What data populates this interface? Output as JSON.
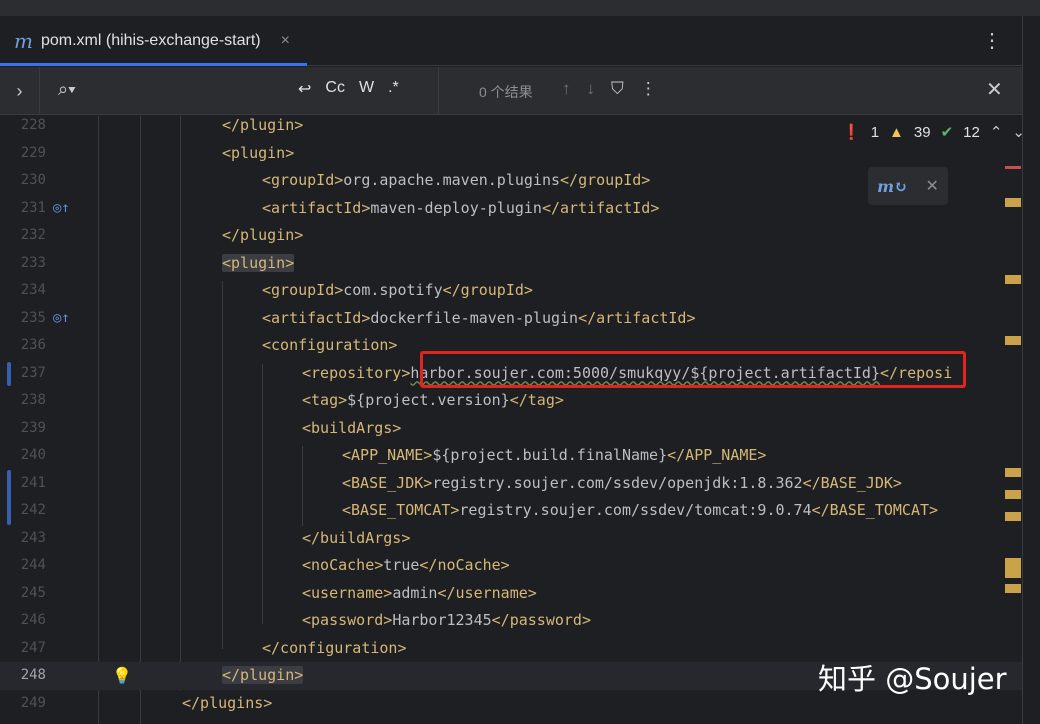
{
  "tab": {
    "icon": "m",
    "title": "pom.xml (hihis-exchange-start)",
    "close": "×",
    "menu": "⋮"
  },
  "findbar": {
    "expand": "›",
    "search_icon": "⌕▾",
    "wrap": "↩",
    "match_case": "Cc",
    "words": "W",
    "regex": ".*",
    "result_count": "0 个结果",
    "prev": "↑",
    "next": "↓",
    "filter": "⛉",
    "more": "⋮",
    "close": "✕"
  },
  "inspections": {
    "errors": "1",
    "warnings": "39",
    "ok": "12"
  },
  "lines": [
    {
      "n": "228",
      "indent": "        ",
      "open": "</plugin>",
      "text": "",
      "close": ""
    },
    {
      "n": "229",
      "indent": "        ",
      "open": "<plugin>",
      "text": "",
      "close": ""
    },
    {
      "n": "230",
      "indent": "            ",
      "open": "<groupId>",
      "text": "org.apache.maven.plugins",
      "close": "</groupId>"
    },
    {
      "n": "231",
      "indent": "            ",
      "open": "<artifactId>",
      "text": "maven-deploy-plugin",
      "close": "</artifactId>"
    },
    {
      "n": "232",
      "indent": "        ",
      "open": "</plugin>",
      "text": "",
      "close": ""
    },
    {
      "n": "233",
      "indent": "        ",
      "open": "<plugin>",
      "text": "",
      "close": ""
    },
    {
      "n": "234",
      "indent": "            ",
      "open": "<groupId>",
      "text": "com.spotify",
      "close": "</groupId>"
    },
    {
      "n": "235",
      "indent": "            ",
      "open": "<artifactId>",
      "text": "dockerfile-maven-plugin",
      "close": "</artifactId>"
    },
    {
      "n": "236",
      "indent": "            ",
      "open": "<configuration>",
      "text": "",
      "close": ""
    },
    {
      "n": "237",
      "indent": "                ",
      "open": "<repository>",
      "text": "harbor.soujer.com:5000/smukqyy/${project.artifactId}",
      "close": "</reposi"
    },
    {
      "n": "238",
      "indent": "                ",
      "open": "<tag>",
      "text": "${project.version}",
      "close": "</tag>"
    },
    {
      "n": "239",
      "indent": "                ",
      "open": "<buildArgs>",
      "text": "",
      "close": ""
    },
    {
      "n": "240",
      "indent": "                    ",
      "open": "<APP_NAME>",
      "text": "${project.build.finalName}",
      "close": "</APP_NAME>"
    },
    {
      "n": "241",
      "indent": "                    ",
      "open": "<BASE_JDK>",
      "text": "registry.soujer.com/ssdev/openjdk:1.8.362",
      "close": "</BASE_JDK>"
    },
    {
      "n": "242",
      "indent": "                    ",
      "open": "<BASE_TOMCAT>",
      "text": "registry.soujer.com/ssdev/tomcat:9.0.74",
      "close": "</BASE_TOMCAT>"
    },
    {
      "n": "243",
      "indent": "                ",
      "open": "</buildArgs>",
      "text": "",
      "close": ""
    },
    {
      "n": "244",
      "indent": "                ",
      "open": "<noCache>",
      "text": "true",
      "close": "</noCache>"
    },
    {
      "n": "245",
      "indent": "                ",
      "open": "<username>",
      "text": "admin",
      "close": "</username>"
    },
    {
      "n": "246",
      "indent": "                ",
      "open": "<password>",
      "text": "Harbor12345",
      "close": "</password>"
    },
    {
      "n": "247",
      "indent": "            ",
      "open": "</configuration>",
      "text": "",
      "close": ""
    },
    {
      "n": "248",
      "indent": "        ",
      "open": "</plugin>",
      "text": "",
      "close": ""
    },
    {
      "n": "249",
      "indent": "    ",
      "open": "</plugins>",
      "text": "",
      "close": ""
    }
  ],
  "watermark": "知乎 @Soujer",
  "colors": {
    "accent": "#3574f0",
    "tag": "#d5b778",
    "text": "#bcbec4",
    "highlight_box": "#e0251d"
  }
}
